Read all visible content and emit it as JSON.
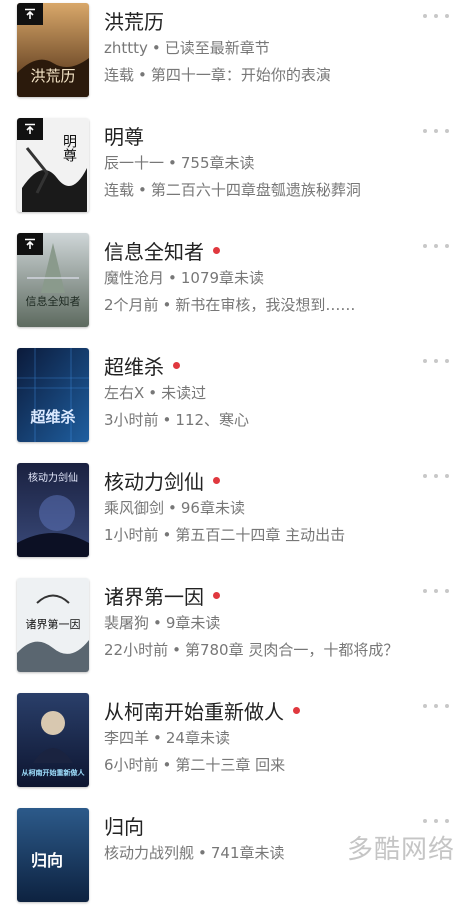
{
  "books": [
    {
      "title": "洪荒历",
      "author": "zhttty",
      "status": "已读至最新章节",
      "extra": "连载",
      "chapter": "第四十一章：开始你的表演",
      "unread_dot": false,
      "pinned": true,
      "cover_text": "洪荒历"
    },
    {
      "title": "明尊",
      "author": "辰一十一",
      "status": "755章未读",
      "extra": "连载",
      "chapter": "第二百六十四章盘瓠遗族秘葬洞",
      "unread_dot": false,
      "pinned": true,
      "cover_text": "明尊"
    },
    {
      "title": "信息全知者",
      "author": "魔性沧月",
      "status": "1079章未读",
      "extra": "2个月前",
      "chapter": "新书在审核，我没想到……",
      "unread_dot": true,
      "pinned": true,
      "cover_text": "信息全知者"
    },
    {
      "title": "超维杀",
      "author": "左右X",
      "status": "未读过",
      "extra": "3小时前",
      "chapter": "112、寒心",
      "unread_dot": true,
      "pinned": false,
      "cover_text": "超维杀"
    },
    {
      "title": "核动力剑仙",
      "author": "乘风御剑",
      "status": "96章未读",
      "extra": "1小时前",
      "chapter": "第五百二十四章 主动出击",
      "unread_dot": true,
      "pinned": false,
      "cover_text": "核动力剑仙"
    },
    {
      "title": "诸界第一因",
      "author": "裴屠狗",
      "status": "9章未读",
      "extra": "22小时前",
      "chapter": "第780章 灵肉合一，十都将成？",
      "unread_dot": true,
      "pinned": false,
      "cover_text": "诸界第一因"
    },
    {
      "title": "从柯南开始重新做人",
      "author": "李四羊",
      "status": "24章未读",
      "extra": "6小时前",
      "chapter": "第二十三章 回来",
      "unread_dot": true,
      "pinned": false,
      "cover_text": "从柯南开始重新做人"
    },
    {
      "title": "归向",
      "author": "核动力战列舰",
      "status": "741章未读",
      "extra": "",
      "chapter": "",
      "unread_dot": false,
      "pinned": false,
      "cover_text": "归向"
    }
  ],
  "separator": "•",
  "icons": {
    "pin": "pin-to-top-icon",
    "more": "more-dots-icon"
  },
  "colors": {
    "unread_dot": "#e0383e",
    "title": "#222222",
    "meta": "#777777"
  },
  "watermark": "多酷网络"
}
